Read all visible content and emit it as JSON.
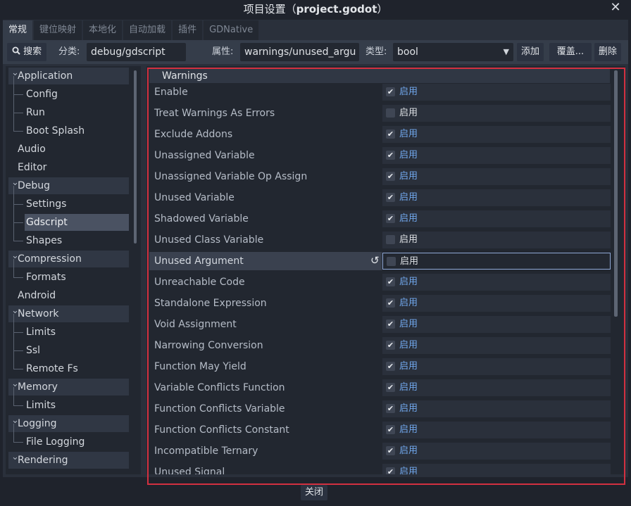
{
  "window": {
    "title_prefix": "项目设置（",
    "title_project": "project.godot",
    "title_suffix": "）",
    "close_glyph": "✕"
  },
  "tabs": [
    {
      "label": "常规",
      "active": true
    },
    {
      "label": "键位映射",
      "active": false
    },
    {
      "label": "本地化",
      "active": false
    },
    {
      "label": "自动加载",
      "active": false
    },
    {
      "label": "插件",
      "active": false
    },
    {
      "label": "GDNative",
      "active": false
    }
  ],
  "toolbar": {
    "search_label": "搜索",
    "category_label": "分类:",
    "category_value": "debug/gdscript",
    "property_label": "属性:",
    "property_value": "warnings/unused_argu",
    "type_label": "类型:",
    "type_value": "bool",
    "add_label": "添加",
    "override_label": "覆盖...",
    "delete_label": "删除"
  },
  "sidebar": {
    "items": [
      {
        "label": "Application",
        "level": 0,
        "category": true
      },
      {
        "label": "Config",
        "level": 1
      },
      {
        "label": "Run",
        "level": 1
      },
      {
        "label": "Boot Splash",
        "level": 1
      },
      {
        "label": "Audio",
        "level": 0
      },
      {
        "label": "Editor",
        "level": 0
      },
      {
        "label": "Debug",
        "level": 0,
        "category": true
      },
      {
        "label": "Settings",
        "level": 1
      },
      {
        "label": "Gdscript",
        "level": 1,
        "selected": true
      },
      {
        "label": "Shapes",
        "level": 1
      },
      {
        "label": "Compression",
        "level": 0,
        "category": true
      },
      {
        "label": "Formats",
        "level": 1
      },
      {
        "label": "Android",
        "level": 0
      },
      {
        "label": "Network",
        "level": 0,
        "category": true
      },
      {
        "label": "Limits",
        "level": 1
      },
      {
        "label": "Ssl",
        "level": 1
      },
      {
        "label": "Remote Fs",
        "level": 1
      },
      {
        "label": "Memory",
        "level": 0,
        "category": true
      },
      {
        "label": "Limits",
        "level": 1
      },
      {
        "label": "Logging",
        "level": 0,
        "category": true
      },
      {
        "label": "File Logging",
        "level": 1
      },
      {
        "label": "Rendering",
        "level": 0,
        "category": true
      }
    ]
  },
  "inspector": {
    "section": "Warnings",
    "on_label": "启用",
    "properties": [
      {
        "name": "Enable",
        "checked": true
      },
      {
        "name": "Treat Warnings As Errors",
        "checked": false
      },
      {
        "name": "Exclude Addons",
        "checked": true
      },
      {
        "name": "Unassigned Variable",
        "checked": true
      },
      {
        "name": "Unassigned Variable Op Assign",
        "checked": true
      },
      {
        "name": "Unused Variable",
        "checked": true
      },
      {
        "name": "Shadowed Variable",
        "checked": true
      },
      {
        "name": "Unused Class Variable",
        "checked": false
      },
      {
        "name": "Unused Argument",
        "checked": false,
        "highlighted": true
      },
      {
        "name": "Unreachable Code",
        "checked": true
      },
      {
        "name": "Standalone Expression",
        "checked": true
      },
      {
        "name": "Void Assignment",
        "checked": true
      },
      {
        "name": "Narrowing Conversion",
        "checked": true
      },
      {
        "name": "Function May Yield",
        "checked": true
      },
      {
        "name": "Variable Conflicts Function",
        "checked": true
      },
      {
        "name": "Function Conflicts Variable",
        "checked": true
      },
      {
        "name": "Function Conflicts Constant",
        "checked": true
      },
      {
        "name": "Incompatible Ternary",
        "checked": true
      },
      {
        "name": "Unused Signal",
        "checked": true
      }
    ]
  },
  "footer": {
    "close_label": "关闭"
  },
  "colors": {
    "accent": "#71a8ee",
    "highlight_frame": "#d23040"
  }
}
